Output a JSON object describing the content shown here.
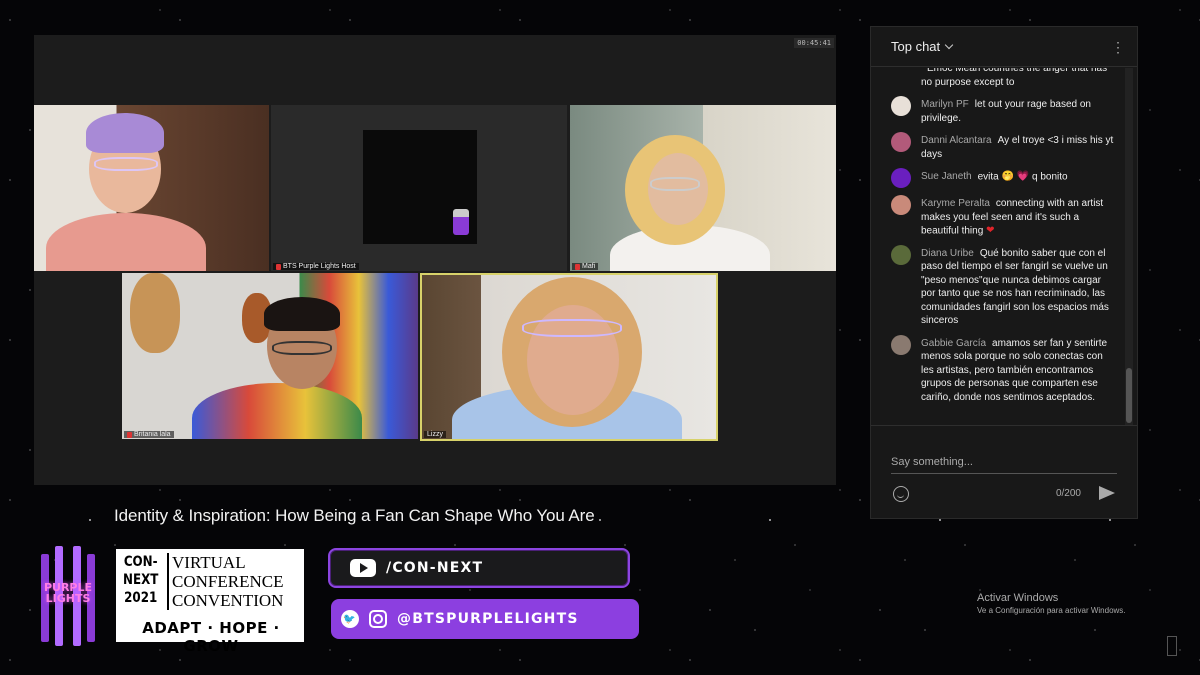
{
  "meeting": {
    "timer": "00:45:41",
    "tiles": [
      {
        "name": ""
      },
      {
        "name": "BTS Purple Lights Host"
      },
      {
        "name": "Mafi"
      },
      {
        "name": "Britania lala"
      },
      {
        "name": "Lizzy"
      }
    ]
  },
  "talk_title": "Identity & Inspiration: How Being a Fan Can Shape Who You Are",
  "branding": {
    "logo_text": "PURPLE LIGHTS",
    "conference": {
      "line1": "CON-",
      "line2": "NEXT",
      "line3": "2021",
      "right1": "VIRTUAL",
      "right2": "CONFERENCE",
      "right3": "CONVENTION",
      "tagline": "ADAPT · HOPE · GROW"
    },
    "youtube_handle": "/CON-NEXT",
    "social_handle": "@BTSPURPLELIGHTS"
  },
  "chat": {
    "title": "Top chat",
    "messages": [
      {
        "author": "",
        "text": "Emoc Mean countries the anger that has no purpose except to",
        "avatar_color": "#777"
      },
      {
        "author": "Marilyn PF",
        "text": "let out your rage based on privilege.",
        "avatar_color": "#e8e0d8"
      },
      {
        "author": "Danni Alcantara",
        "text": "Ay el troye <3 i miss his yt days",
        "avatar_color": "#b25a7a"
      },
      {
        "author": "Sue Janeth",
        "text": "evita",
        "text_after": "q bonito",
        "emoji1": "🤭",
        "emoji2": "💗",
        "avatar_color": "#6a1fbf"
      },
      {
        "author": "Karyme Peralta",
        "text": "connecting with an artist makes you feel seen and it's such a beautiful thing",
        "emoji": "❤",
        "avatar_color": "#c98a7a"
      },
      {
        "author": "Diana Uribe",
        "text": "Qué bonito saber que con el paso del tiempo el ser fangirl se vuelve un \"peso menos\"que nunca debimos cargar por tanto que se nos han recriminado, las comunidades fangirl son los espacios más sinceros",
        "avatar_color": "#5a6a3a"
      },
      {
        "author": "Gabbie García",
        "text": "amamos ser fan y sentirte menos sola porque no solo conectas con les artistas, pero también encontramos grupos de personas que comparten ese cariño, donde nos sentimos aceptados.",
        "avatar_color": "#8a7a70"
      }
    ],
    "input_placeholder": "Say something...",
    "char_count": "0/200"
  },
  "watermark": {
    "line1": "Activar Windows",
    "line2": "Ve a Configuración para activar Windows."
  },
  "colors": {
    "accent_purple": "#8c3fe0",
    "pink_glow": "#ff7ee6"
  }
}
